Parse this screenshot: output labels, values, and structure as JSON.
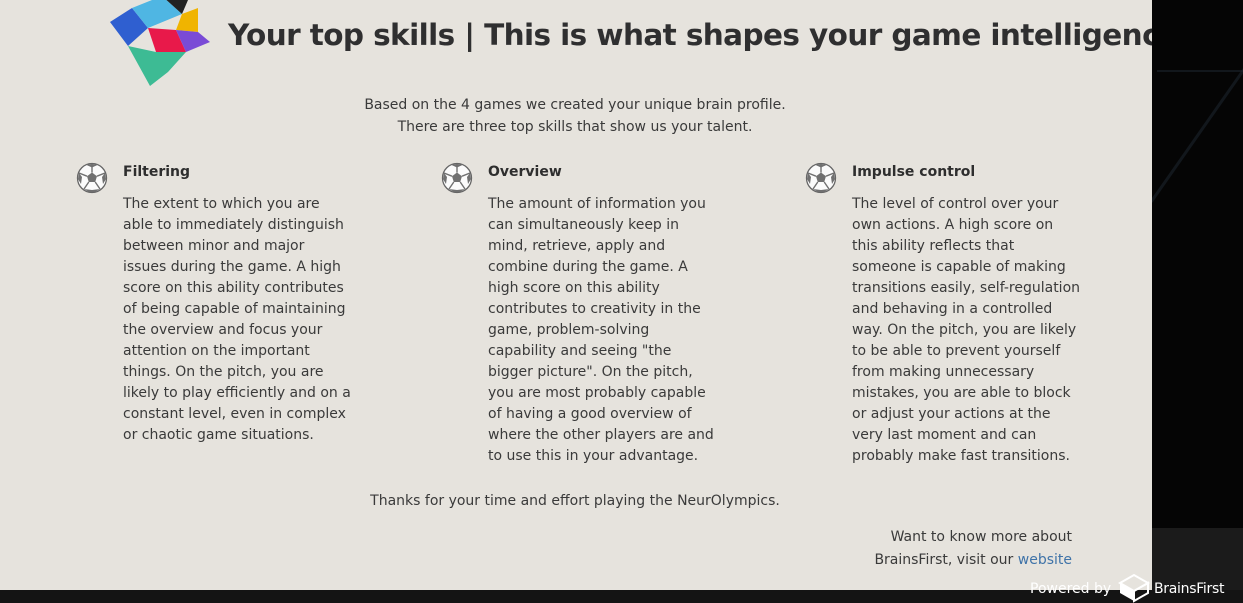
{
  "header": {
    "title": "Your top skills | This is what shapes your game intelligence"
  },
  "intro": {
    "line1": "Based on the 4 games we created your unique brain profile.",
    "line2": "There are three top skills that show us your talent."
  },
  "skills": [
    {
      "icon": "soccer-ball-icon",
      "title": "Filtering",
      "description": "The extent to which you are able to immediately distinguish between minor and major issues during the game. A high score on this ability contributes of being capable of maintaining the overview and focus your attention on the important things. On the pitch, you are likely to play efficiently and on a constant level, even in complex or chaotic game situations."
    },
    {
      "icon": "soccer-ball-icon",
      "title": "Overview",
      "description": "The amount of information you can simultaneously keep in mind, retrieve, apply and combine during the game. A high score on this ability contributes to creativity in the game, problem-solving capability and seeing \"the bigger picture\". On the pitch, you are most probably capable of having a good overview of where the other players are and to use this in your advantage."
    },
    {
      "icon": "soccer-ball-icon",
      "title": "Impulse control",
      "description": "The level of control over your own actions. A high score on this ability reflects that someone is capable of making transitions easily, self-regulation and behaving in a controlled way. On the pitch, you are likely to be able to prevent yourself from making unnecessary mistakes, you are able to block or adjust your actions at the very last moment and can probably make fast transitions."
    }
  ],
  "footer": {
    "thanks": "Thanks for your time and effort playing the NeurOlympics.",
    "more_line1": "Want to know more about",
    "more_line2_prefix": "BrainsFirst, visit our ",
    "more_link": "website",
    "powered_by": "Powered by",
    "brand": "BrainsFirst"
  },
  "colors": {
    "panel_background": "#e6e3dd",
    "title_text": "#2f2f30",
    "body_text": "#3a3a3a",
    "link": "#3f73a8",
    "page_background": "#0b0b0b"
  }
}
